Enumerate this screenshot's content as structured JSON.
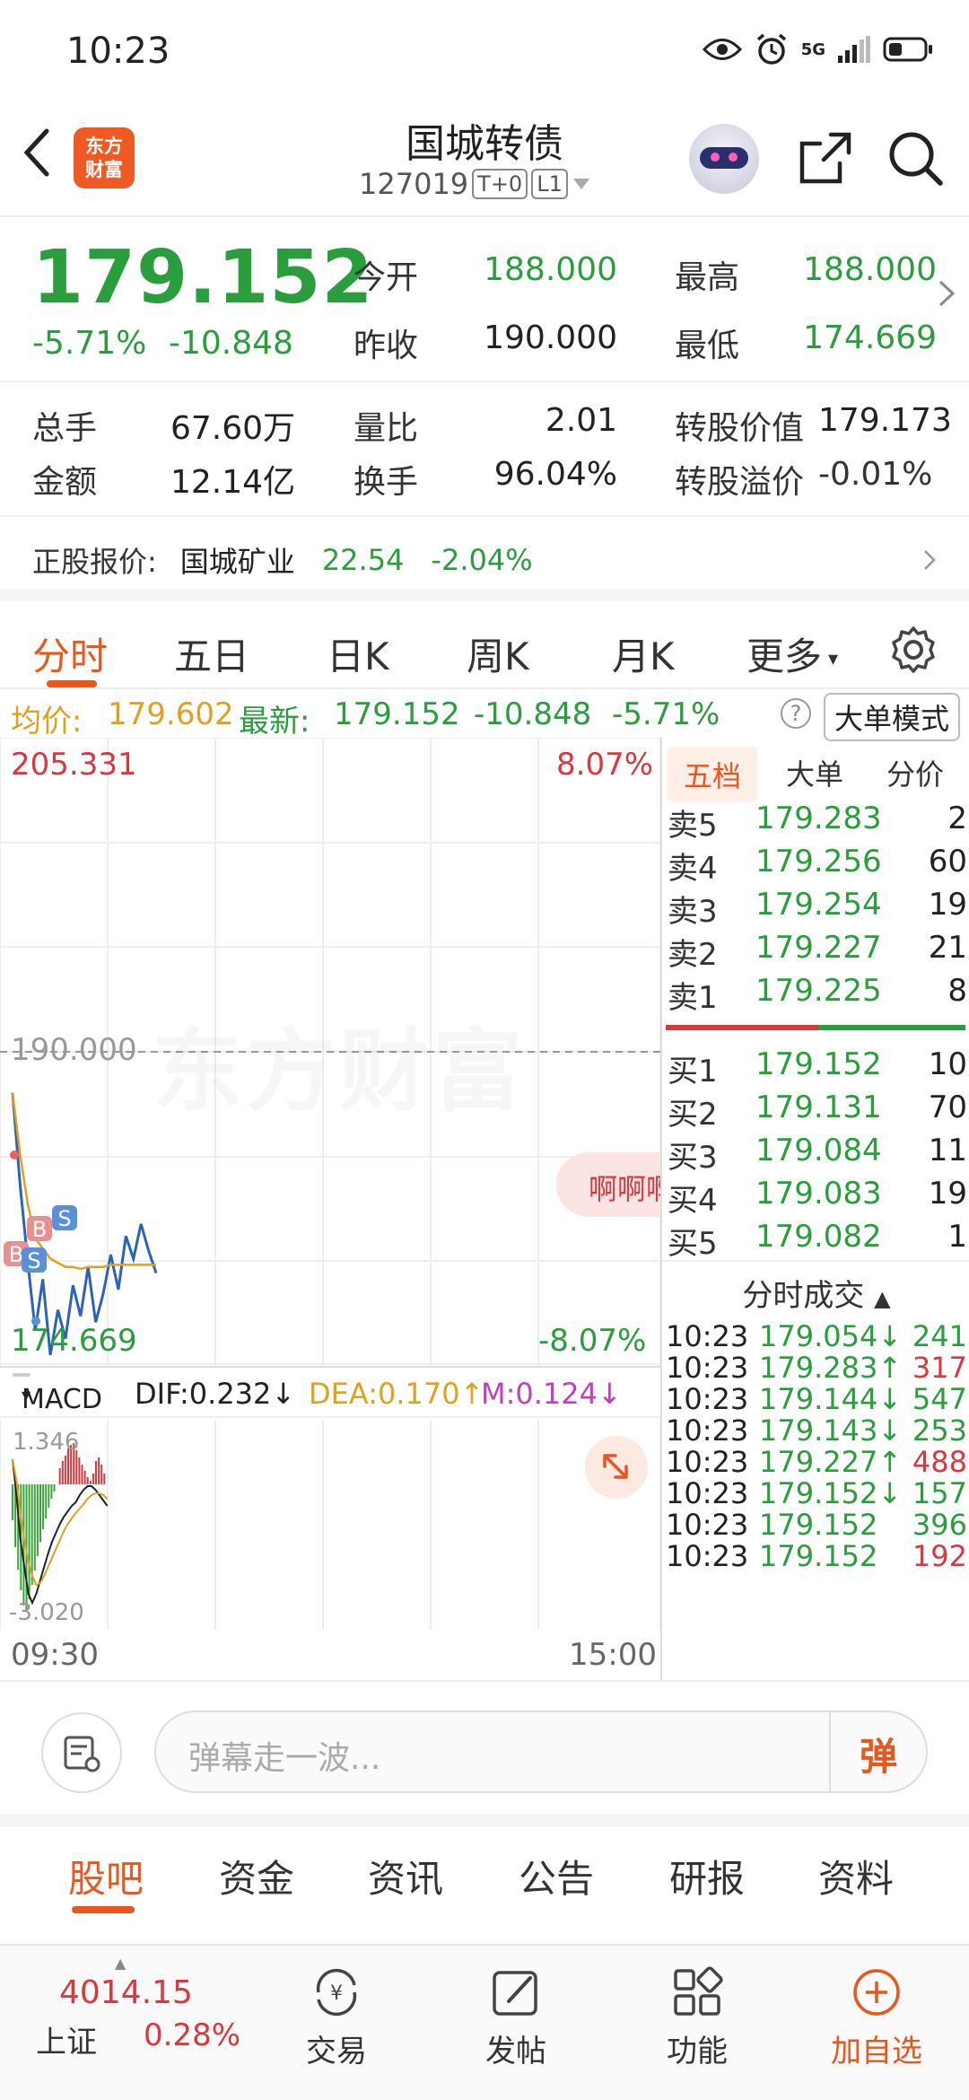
{
  "status_bar": {
    "time": "10:23",
    "signal": "5G"
  },
  "header": {
    "title": "国城转债",
    "code": "127019",
    "tag1": "T+0",
    "tag2": "L1",
    "logo_line1": "东方",
    "logo_line2": "财富"
  },
  "quote": {
    "price": "179.152",
    "change_pct": "-5.71%",
    "change_amt": "-10.848",
    "open_label": "今开",
    "open": "188.000",
    "high_label": "最高",
    "high": "188.000",
    "prev_close_label": "昨收",
    "prev_close": "190.000",
    "low_label": "最低",
    "low": "174.669",
    "volume_label": "总手",
    "volume": "67.60万",
    "vol_ratio_label": "量比",
    "vol_ratio": "2.01",
    "conv_value_label": "转股价值",
    "conv_value": "179.173",
    "amount_label": "金额",
    "amount": "12.14亿",
    "turnover_label": "换手",
    "turnover": "96.04%",
    "premium_label": "转股溢价",
    "premium": "-0.01%",
    "underlying_label": "正股报价:",
    "underlying_name": "国城矿业",
    "underlying_price": "22.54",
    "underlying_change": "-2.04%"
  },
  "chart_tabs": [
    "分时",
    "五日",
    "日K",
    "周K",
    "月K",
    "更多"
  ],
  "info_line": {
    "avg_label": "均价:",
    "avg_value": "179.602",
    "latest_label": "最新:",
    "latest_value": "179.152",
    "latest_chg": "-10.848",
    "latest_pct": "-5.71%",
    "mode_button": "大单模式"
  },
  "chart": {
    "top_price": "205.331",
    "top_pct": "8.07%",
    "base_price": "190.000",
    "bottom_price": "174.669",
    "bottom_pct": "-8.07%",
    "watermark": "东方财富",
    "bubble_text": "啊啊啊",
    "macd_select": "MACD",
    "dif": "DIF:0.232↓",
    "dea": "DEA:0.170↑",
    "m": "M:0.124↓",
    "macd_top": "1.346",
    "macd_bottom": "-3.020",
    "time_start": "09:30",
    "time_end": "15:00",
    "marker_b": "B",
    "marker_s": "S"
  },
  "chart_data": {
    "type": "line",
    "title": "",
    "ylim": [
      174.669,
      205.331
    ],
    "series": [
      {
        "values": [
          188.0,
          183.5,
          179.8,
          176.4,
          178.9,
          175.2,
          177.4,
          176.0,
          178.6,
          177.1,
          179.5,
          176.8,
          178.2,
          180.1,
          178.4,
          181.0,
          179.9,
          181.6,
          180.3,
          179.2
        ]
      },
      {
        "values": [
          188.0,
          185.0,
          182.6,
          180.9,
          180.4,
          179.9,
          179.7,
          179.5,
          179.5,
          179.4,
          179.5,
          179.5,
          179.5,
          179.6,
          179.6,
          179.6,
          179.6,
          179.6,
          179.6,
          179.6
        ]
      }
    ]
  },
  "depth": {
    "tabs": [
      "五档",
      "大单",
      "分价"
    ],
    "asks": [
      {
        "label": "卖5",
        "price": "179.283",
        "vol": "2"
      },
      {
        "label": "卖4",
        "price": "179.256",
        "vol": "60"
      },
      {
        "label": "卖3",
        "price": "179.254",
        "vol": "19"
      },
      {
        "label": "卖2",
        "price": "179.227",
        "vol": "21"
      },
      {
        "label": "卖1",
        "price": "179.225",
        "vol": "8"
      }
    ],
    "bids": [
      {
        "label": "买1",
        "price": "179.152",
        "vol": "10"
      },
      {
        "label": "买2",
        "price": "179.131",
        "vol": "70"
      },
      {
        "label": "买3",
        "price": "179.084",
        "vol": "11"
      },
      {
        "label": "买4",
        "price": "179.083",
        "vol": "19"
      },
      {
        "label": "买5",
        "price": "179.082",
        "vol": "1"
      }
    ],
    "ticks_title": "分时成交",
    "ticks": [
      {
        "time": "10:23",
        "price": "179.054↓",
        "vol": "241",
        "dir": "down"
      },
      {
        "time": "10:23",
        "price": "179.283↑",
        "vol": "317",
        "dir": "up"
      },
      {
        "time": "10:23",
        "price": "179.144↓",
        "vol": "547",
        "dir": "down"
      },
      {
        "time": "10:23",
        "price": "179.143↓",
        "vol": "253",
        "dir": "down"
      },
      {
        "time": "10:23",
        "price": "179.227↑",
        "vol": "488",
        "dir": "up"
      },
      {
        "time": "10:23",
        "price": "179.152↓",
        "vol": "157",
        "dir": "down"
      },
      {
        "time": "10:23",
        "price": "179.152",
        "vol": "396",
        "dir": "flat"
      },
      {
        "time": "10:23",
        "price": "179.152",
        "vol": "192",
        "dir": "up"
      }
    ]
  },
  "danmu": {
    "placeholder": "弹幕走一波...",
    "send": "弹"
  },
  "bottom_tabs": [
    "股吧",
    "资金",
    "资讯",
    "公告",
    "研报",
    "资料"
  ],
  "nav": {
    "index_value": "4014.15",
    "index_name": "上证",
    "index_pct": "0.28%",
    "items": [
      "交易",
      "发帖",
      "功能",
      "加自选"
    ]
  }
}
